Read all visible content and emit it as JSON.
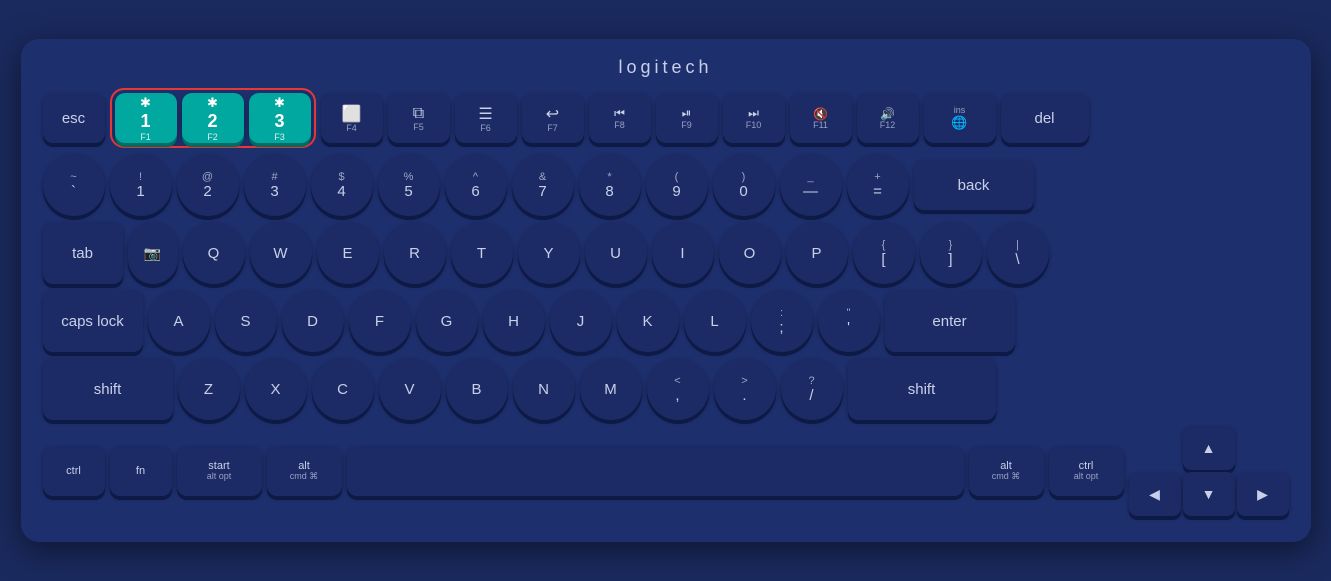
{
  "brand": "logitech",
  "rows": {
    "fn_row": {
      "esc": "esc",
      "bt1": {
        "icon": "✱",
        "num": "1",
        "fn": "F1"
      },
      "bt2": {
        "icon": "✱",
        "num": "2",
        "fn": "F2"
      },
      "bt3": {
        "icon": "✱",
        "num": "3",
        "fn": "F3"
      },
      "f4": {
        "icon": "⬜",
        "fn": "F4"
      },
      "f5": {
        "icon": "⧉",
        "fn": "F5"
      },
      "f6": {
        "icon": "≡",
        "fn": "F6"
      },
      "f7": {
        "icon": "↩",
        "fn": "F7"
      },
      "f8": {
        "icon": "◀◀",
        "fn": "F8"
      },
      "f9": {
        "icon": "▶⏸",
        "fn": "F9"
      },
      "f10": {
        "icon": "▶▶",
        "fn": "F10"
      },
      "f11": {
        "icon": "🔇",
        "fn": "F11"
      },
      "f12": {
        "icon": "🔊",
        "fn": "F12"
      },
      "ins": {
        "top": "ins",
        "icon": "🌐"
      },
      "del": "del"
    },
    "number_row": [
      {
        "top": "~",
        "bot": "`"
      },
      {
        "top": "!",
        "bot": "1"
      },
      {
        "top": "@",
        "bot": "2"
      },
      {
        "top": "#",
        "bot": "3"
      },
      {
        "top": "$",
        "bot": "4"
      },
      {
        "top": "%",
        "bot": "5"
      },
      {
        "top": "^",
        "bot": "6"
      },
      {
        "top": "&",
        "bot": "7"
      },
      {
        "top": "*",
        "bot": "8"
      },
      {
        "top": "(",
        "bot": "9"
      },
      {
        "top": ")",
        "bot": "0"
      },
      {
        "top": "_",
        "bot": "—"
      },
      {
        "top": "+",
        "bot": "="
      }
    ],
    "qwerty": [
      "Q",
      "W",
      "E",
      "R",
      "T",
      "Y",
      "U",
      "I",
      "O",
      "P"
    ],
    "asdf": [
      "A",
      "S",
      "D",
      "F",
      "G",
      "H",
      "J",
      "K",
      "L"
    ],
    "zxcv": [
      "Z",
      "X",
      "C",
      "V",
      "B",
      "N",
      "M"
    ],
    "brackets": [
      {
        "top": "{",
        "bot": "["
      },
      {
        "top": "}",
        "bot": "]"
      },
      {
        "top": "|",
        "bot": "\\"
      }
    ],
    "punctuation_mid": [
      {
        "top": ":",
        "bot": ";"
      },
      {
        "top": "\"",
        "bot": "'"
      }
    ],
    "punctuation_bot": [
      {
        "top": "<",
        "bot": ","
      },
      {
        "top": ">",
        "bot": "."
      },
      {
        "top": "?",
        "bot": "/"
      }
    ],
    "bottom": {
      "ctrl": "ctrl",
      "fn": "fn",
      "start": {
        "main": "start",
        "sub": "alt opt"
      },
      "alt": {
        "main": "alt",
        "sub": "cmd ⌘"
      },
      "alt_r": {
        "main": "alt",
        "sub": "cmd ⌘"
      },
      "ctrl_r": {
        "main": "ctrl",
        "sub": "alt opt"
      }
    }
  },
  "labels": {
    "back": "back",
    "tab": "tab",
    "caps_lock": "caps lock",
    "shift": "shift",
    "enter": "enter",
    "del": "del"
  }
}
